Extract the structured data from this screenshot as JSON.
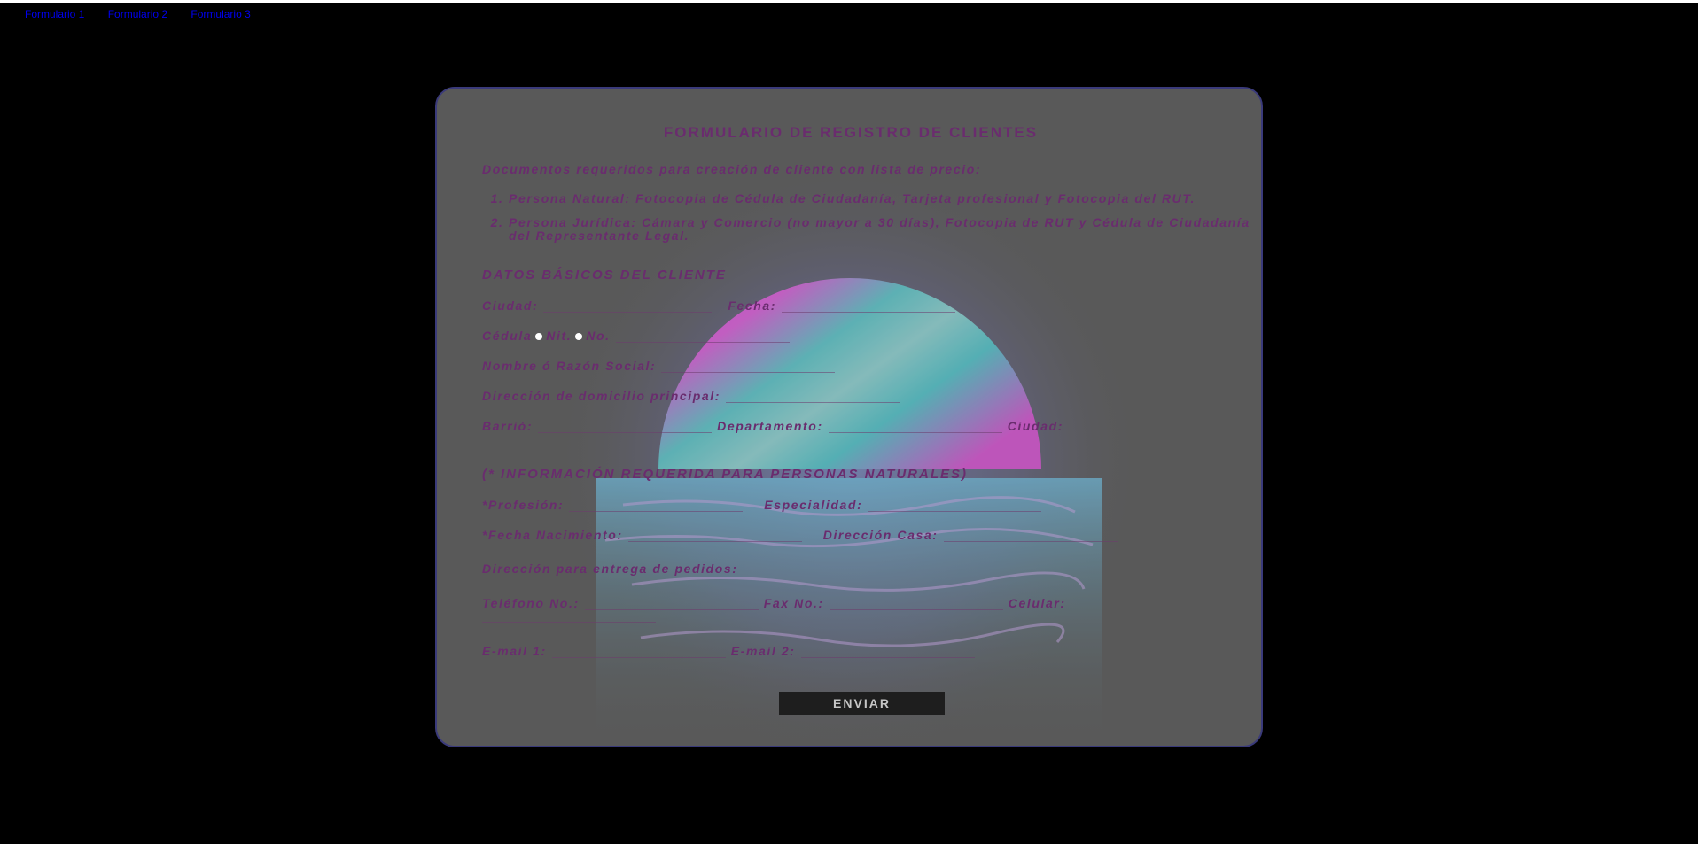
{
  "nav": {
    "links": [
      "Formulario 1",
      "Formulario 2",
      "Formulario 3"
    ]
  },
  "form": {
    "title": "FORMULARIO DE REGISTRO DE CLIENTES",
    "intro": "Documentos requeridos para creación de cliente con lista de precio:",
    "docs": [
      "Persona Natural: Fotocopia de Cédula de Ciudadanía, Tarjeta profesional y Fotocopia del RUT.",
      "Persona Jurídica: Cámara y Comercio (no mayor a 30 días), Fotocopia de RUT y Cédula de Ciudadanía del Representante Legal."
    ],
    "section_basic": "DATOS BÁSICOS DEL CLIENTE",
    "ciudad": "Ciudad:",
    "fecha": "Fecha:",
    "cedula": "Cédula",
    "nit": "Nit.",
    "no": "No.",
    "nombre": "Nombre ó Razón Social:",
    "direccion_principal": "Dirección de domicilio principal:",
    "barrio": "Barrió:",
    "departamento": "Departamento:",
    "ciudad2": "Ciudad:",
    "section_natural": "(* INFORMACIÓN REQUERIDA PARA PERSONAS NATURALES)",
    "profesion": "*Profesión:",
    "especialidad": "Especialidad:",
    "fecha_nacimiento": "*Fecha Nacimiento:",
    "direccion_casa": "Dirección Casa:",
    "direccion_entrega": "Dirección para entrega de pedidos:",
    "telefono": "Teléfono No.:",
    "fax": "Fax No.:",
    "celular": "Celular:",
    "email1": "E-mail 1:",
    "email2": "E-mail 2:",
    "submit": "ENVIAR"
  },
  "colors": {
    "card_bg": "#5a5a5a",
    "label": "#6a2c6e",
    "border": "#3a3a7a",
    "button_bg": "#1e1e1e",
    "link": "#0000ee"
  }
}
